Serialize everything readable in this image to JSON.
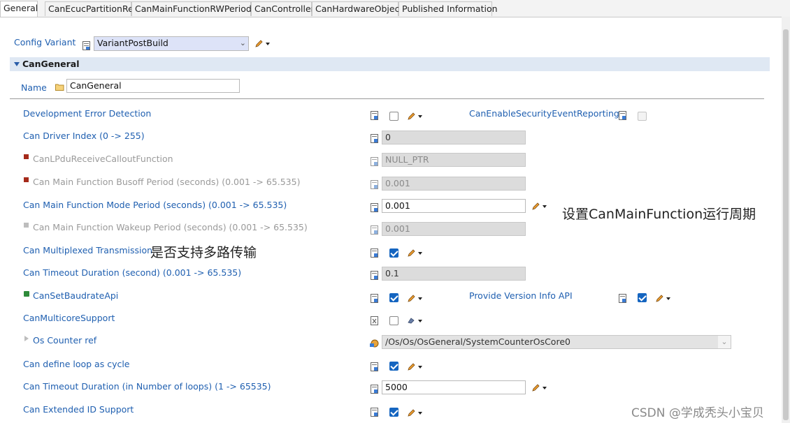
{
  "tabs": [
    "General",
    "CanEcucPartitionRef",
    "CanMainFunctionRWPeriods",
    "CanController",
    "CanHardwareObject",
    "Published Information"
  ],
  "config_variant": {
    "label": "Config Variant",
    "value": "VariantPostBuild"
  },
  "section": {
    "title": "CanGeneral"
  },
  "name_field": {
    "label": "Name",
    "value": "CanGeneral"
  },
  "rows": {
    "dev_error": {
      "label": "Development Error Detection"
    },
    "security_event": {
      "label": "CanEnableSecurityEventReporting"
    },
    "driver_index": {
      "label": "Can Driver Index (0 -> 255)",
      "value": "0"
    },
    "lpdu_callout": {
      "label": "CanLPduReceiveCalloutFunction",
      "value": "NULL_PTR"
    },
    "busoff_period": {
      "label": "Can Main Function Busoff Period (seconds) (0.001 -> 65.535)",
      "value": "0.001"
    },
    "mode_period": {
      "label": "Can Main Function Mode Period (seconds) (0.001 -> 65.535)",
      "value": "0.001"
    },
    "wakeup_period": {
      "label": "Can Main Function Wakeup Period (seconds) (0.001 -> 65.535)",
      "value": "0.001"
    },
    "multiplexed": {
      "label": "Can Multiplexed Transmission"
    },
    "timeout_sec": {
      "label": "Can Timeout Duration (second) (0.001 -> 65.535)",
      "value": "0.1"
    },
    "set_baudrate": {
      "label": "CanSetBaudrateApi"
    },
    "version_info": {
      "label": "Provide Version Info API"
    },
    "multicore": {
      "label": "CanMulticoreSupport"
    },
    "os_counter": {
      "label": "Os Counter ref",
      "value": "/Os/Os/OsGeneral/SystemCounterOsCore0"
    },
    "loop_cycle": {
      "label": "Can define loop as cycle"
    },
    "timeout_loops": {
      "label": "Can Timeout Duration (in Number of loops) (1 -> 65535)",
      "value": "5000"
    },
    "extended_id": {
      "label": "Can Extended ID Support"
    }
  },
  "annotations": {
    "mode_period_note": "设置CanMainFunction运行周期",
    "multiplexed_note": "是否支持多路传输",
    "watermark": "CSDN @学成秃头小宝贝"
  },
  "checkboxes": {
    "dev_error": false,
    "security_event": false,
    "multiplexed": true,
    "set_baudrate": true,
    "version_info": true,
    "multicore": false,
    "loop_cycle": true,
    "extended_id": true
  },
  "colors": {
    "label_blue": "#1f5fb0",
    "checkbox_blue": "#1565c0",
    "disabled_gray": "#9a9a9a",
    "section_bg": "#dfe8f3"
  },
  "icons": [
    "config-doc-icon",
    "folder-icon",
    "pencil-icon",
    "dropdown-arrow-icon",
    "link-icon",
    "red-marker-icon",
    "green-marker-icon",
    "gray-marker-icon",
    "expand-arrow-icon"
  ]
}
